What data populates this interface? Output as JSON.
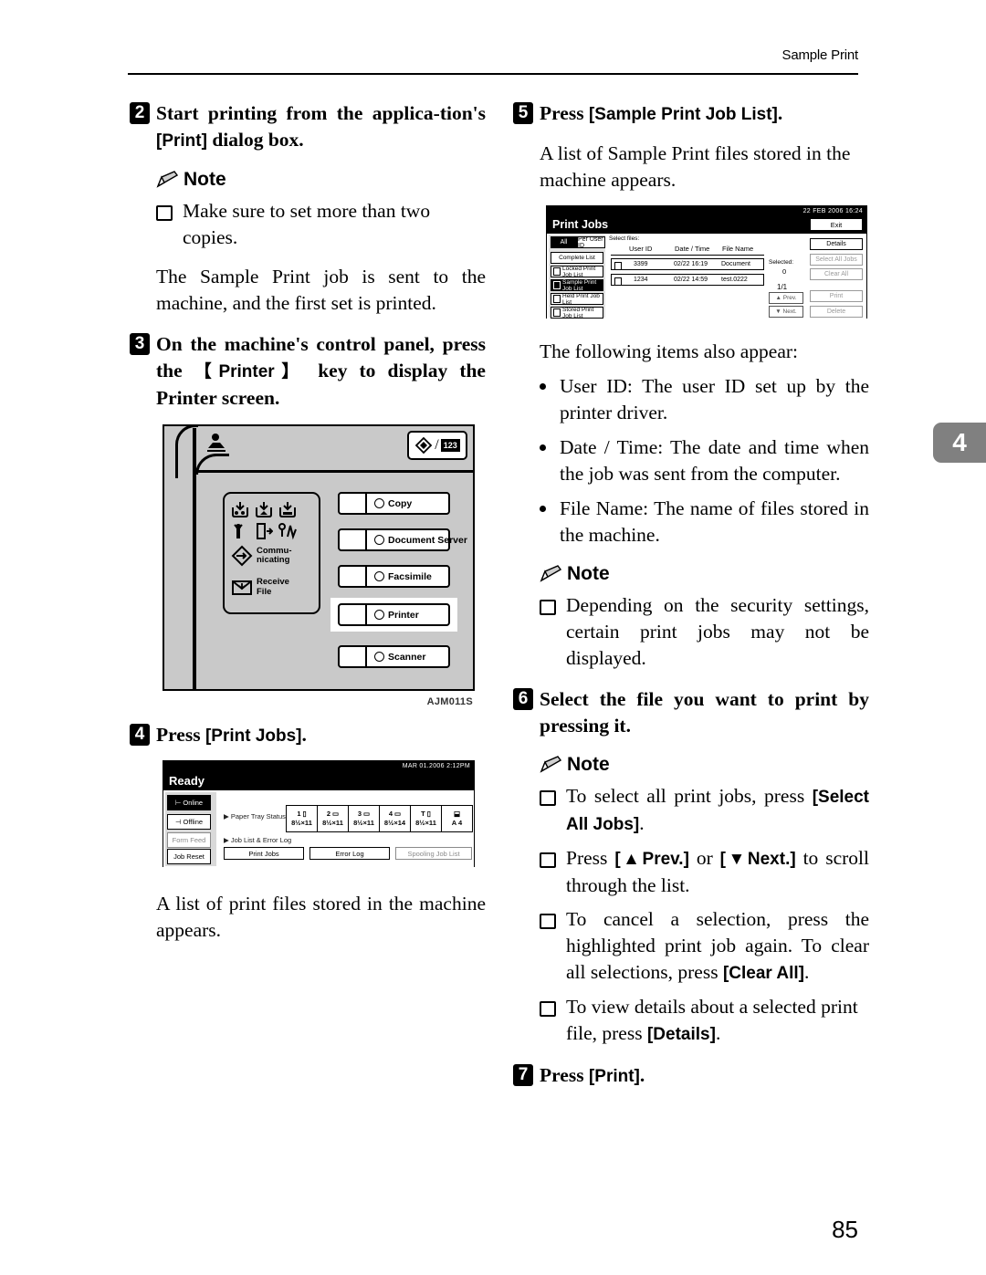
{
  "page": {
    "running_head": "Sample Print",
    "page_number": "85",
    "chapter_tab": "4"
  },
  "left_column": {
    "step2": {
      "number": "2",
      "text_part1": "Start printing from the applica-tion's ",
      "key": "[Print]",
      "text_part2": " dialog box."
    },
    "note1": {
      "heading": "Note",
      "items": [
        "Make sure to set more than two copies."
      ]
    },
    "para1": "The Sample Print job is sent to the machine, and the first set is printed.",
    "step3": {
      "number": "3",
      "text_part1": "On the machine's control panel, press the ",
      "key": "【Printer】",
      "text_part2": " key to display the Printer screen."
    },
    "figure_panel": {
      "caption": "AJM011S",
      "indicators": [
        "Commu-nicating",
        "Receive File"
      ],
      "indicator_line1": "Commu-",
      "indicator_line2": "nicating",
      "indicator_line3": "Receive",
      "indicator_line4": "File",
      "start_key_label": "123",
      "mode_keys": [
        {
          "label": "Copy",
          "highlighted": false
        },
        {
          "label": "Document  Server",
          "highlighted": false
        },
        {
          "label": "Facsimile",
          "highlighted": false
        },
        {
          "label": "Printer",
          "highlighted": true
        },
        {
          "label": "Scanner",
          "highlighted": false
        }
      ]
    },
    "step4": {
      "number": "4",
      "text_part1": "Press ",
      "key": "[Print Jobs]",
      "text_part2": "."
    },
    "figure_ready": {
      "status_bar": "MAR  01.2006   2:12PM",
      "title": "Ready",
      "side_buttons": [
        {
          "label": "Online",
          "state": "on"
        },
        {
          "label": "Offline",
          "state": "normal"
        },
        {
          "label": "Form Feed",
          "state": "dim"
        },
        {
          "label": "Job Reset",
          "state": "normal"
        }
      ],
      "tray_status_label": "Paper Tray Status",
      "job_list_label": "Job List & Error Log",
      "trays": [
        {
          "num": "1",
          "size": "8½×11"
        },
        {
          "num": "2",
          "size": "8½×11"
        },
        {
          "num": "3",
          "size": "8½×11"
        },
        {
          "num": "4",
          "size": "8½×14"
        },
        {
          "num": "T",
          "size": "8½×11"
        },
        {
          "num": "",
          "size": "A 4"
        }
      ],
      "buttons": [
        {
          "label": "Print Jobs",
          "state": "normal"
        },
        {
          "label": "Error Log",
          "state": "normal"
        },
        {
          "label": "Spooling Job List",
          "state": "dim"
        }
      ]
    },
    "para2": "A list of print files stored in the machine appears."
  },
  "right_column": {
    "step5": {
      "number": "5",
      "text_part1": "Press ",
      "key": "[Sample Print Job List]",
      "text_part2": "."
    },
    "para1": "A list of Sample Print files stored in the machine appears.",
    "figure_jobs": {
      "status_bar": "22 FEB  2006 16:24",
      "title": "Print Jobs",
      "exit_label": "Exit",
      "select_files_label": "Select files:",
      "filter_all": "All",
      "filter_per_user": "Per User ID",
      "list_buttons": [
        {
          "label": "Complete List",
          "selected": false,
          "icon": false
        },
        {
          "label": "Locked Print Job List",
          "selected": false,
          "icon": true
        },
        {
          "label": "Sample Print Job List",
          "selected": true,
          "icon": true
        },
        {
          "label": "Held Print Job List",
          "selected": false,
          "icon": true
        },
        {
          "label": "Stored Print Job List",
          "selected": false,
          "icon": true
        }
      ],
      "columns": [
        "User ID",
        "Date / Time",
        "File Name"
      ],
      "rows": [
        {
          "user_id": "3399",
          "datetime": "02/22  16:19",
          "file_name": "Document"
        },
        {
          "user_id": "1234",
          "datetime": "02/22  14:59",
          "file_name": "test.0222"
        }
      ],
      "selected_label": "Selected:",
      "selected_count": "0",
      "page_indicator": "1/1",
      "prev_label": "▲ Prev.",
      "next_label": "▼ Next.",
      "right_buttons": [
        {
          "label": "Details",
          "state": "normal"
        },
        {
          "label": "Select All Jobs",
          "state": "dim"
        },
        {
          "label": "Clear All",
          "state": "dim"
        },
        {
          "label": "Print",
          "state": "dim"
        },
        {
          "label": "Delete",
          "state": "dim"
        }
      ]
    },
    "para2": "The following items also appear:",
    "bullets": [
      "User ID: The user ID set up by the printer driver.",
      "Date / Time: The date and time when the job was sent from the computer.",
      "File Name: The name of files stored in the machine."
    ],
    "note1": {
      "heading": "Note",
      "items": [
        "Depending on the security settings, certain print jobs may not be displayed."
      ]
    },
    "step6": {
      "number": "6",
      "text": "Select the file you want to print by pressing it."
    },
    "note2": {
      "heading": "Note",
      "item1_part1": "To select all print jobs, press ",
      "item1_key": "[Select All Jobs]",
      "item1_part2": ".",
      "item2_part1": "Press ",
      "item2_key1": "[▲Prev.]",
      "item2_mid": " or ",
      "item2_key2": "[▼Next.]",
      "item2_part2": " to scroll through the list.",
      "item3_part1": "To cancel a selection, press the highlighted print job again. To clear all selections, press ",
      "item3_key": "[Clear All]",
      "item3_part2": ".",
      "item4_part1": "To view details about a selected print file, press ",
      "item4_key": "[Details]",
      "item4_part2": "."
    },
    "step7": {
      "number": "7",
      "text_part1": "Press ",
      "key": "[Print]",
      "text_part2": "."
    }
  }
}
